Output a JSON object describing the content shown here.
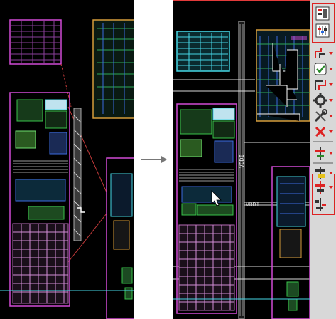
{
  "labels": {
    "vdd_vertical": "VDDI",
    "vdd_horizontal": "VDDI"
  },
  "toolbar": {
    "buttons": [
      {
        "name": "layout-view-icon",
        "has_dropdown": false
      },
      {
        "name": "settings-sliders-icon",
        "has_dropdown": false
      },
      {
        "name": "route-icon",
        "has_dropdown": true
      },
      {
        "name": "check-icon",
        "has_dropdown": true
      },
      {
        "name": "route-alt-icon",
        "has_dropdown": true
      },
      {
        "name": "gear-icon",
        "has_dropdown": true
      },
      {
        "name": "tools-icon",
        "has_dropdown": true
      },
      {
        "name": "close-icon",
        "has_dropdown": true
      },
      {
        "name": "align-icon",
        "has_dropdown": true
      },
      {
        "name": "highlight-icon",
        "has_dropdown": true
      },
      {
        "name": "align-red-icon",
        "has_dropdown": true
      },
      {
        "name": "split-icon",
        "has_dropdown": false
      }
    ]
  },
  "colors": {
    "canvas": "#000000",
    "accent": "#e23a3a",
    "cyan": "#46d7e6",
    "magenta": "#d14bd6",
    "green": "#39c24a",
    "orange": "#d69c3a"
  }
}
